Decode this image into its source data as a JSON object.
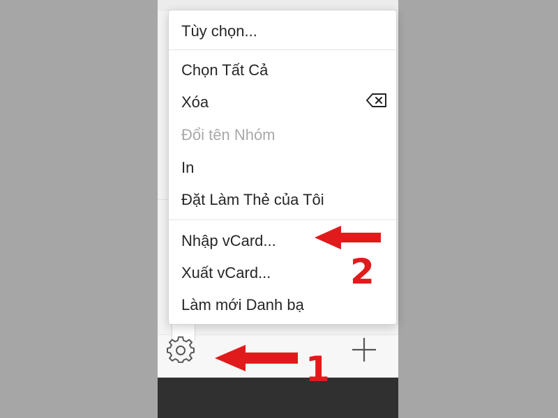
{
  "menu": {
    "items": [
      {
        "label": "Tùy chọn...",
        "enabled": true
      },
      {
        "label": "Chọn Tất Cả",
        "enabled": true
      },
      {
        "label": "Xóa",
        "enabled": true,
        "icon": "delete-key-icon"
      },
      {
        "label": "Đổi tên Nhóm",
        "enabled": false
      },
      {
        "label": "In",
        "enabled": true
      },
      {
        "label": "Đặt Làm Thẻ của Tôi",
        "enabled": true
      },
      {
        "label": "Nhập vCard...",
        "enabled": true
      },
      {
        "label": "Xuất vCard...",
        "enabled": true
      },
      {
        "label": "Làm mới Danh bạ",
        "enabled": true
      }
    ]
  },
  "toolbar": {
    "settings_icon": "gear-icon",
    "add_icon": "plus-icon"
  },
  "annotations": {
    "step1_label": "1",
    "step2_label": "2",
    "color": "#e11b1b"
  },
  "colors": {
    "background": "#a6a6a6",
    "menu_background": "#ffffff",
    "disabled_text": "#a9a9a9",
    "dark_band": "#303030"
  }
}
